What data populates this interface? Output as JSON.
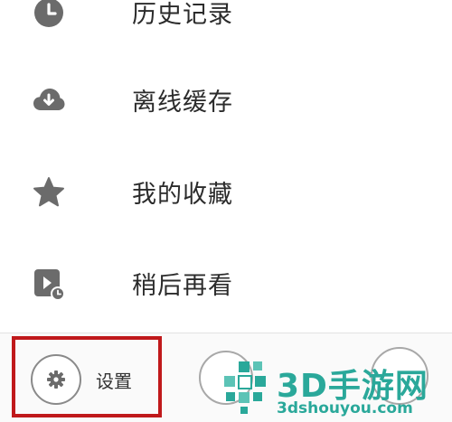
{
  "menu": {
    "items": [
      {
        "label": "历史记录",
        "icon": "history-clock-icon"
      },
      {
        "label": "离线缓存",
        "icon": "cloud-download-icon"
      },
      {
        "label": "我的收藏",
        "icon": "star-icon"
      },
      {
        "label": "稍后再看",
        "icon": "watch-later-icon"
      }
    ]
  },
  "bottom_bar": {
    "settings_label": "设置",
    "settings_icon": "gear-icon"
  },
  "watermark": {
    "title": "3D手游网",
    "url": "3dshouyou.com"
  },
  "colors": {
    "icon": "#6b6b6b",
    "highlight": "#c0191b",
    "watermark": "#2aa89a"
  }
}
